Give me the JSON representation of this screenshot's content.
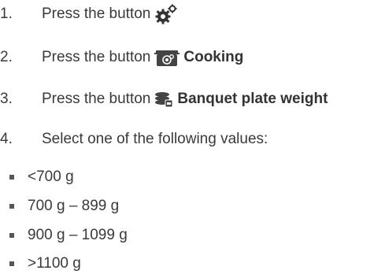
{
  "steps": [
    {
      "number": "1.",
      "text": "Press the button",
      "icon": "gears-icon",
      "label": ""
    },
    {
      "number": "2.",
      "text": "Press the button",
      "icon": "cooking-pot-icon",
      "label": "Cooking"
    },
    {
      "number": "3.",
      "text": "Press the button",
      "icon": "plate-stack-icon",
      "label": "Banquet plate weight"
    },
    {
      "number": "4.",
      "text": "Select one of the following values:"
    }
  ],
  "values": [
    "<700 g",
    "700 g – 899 g",
    "900 g – 1099 g",
    ">1100 g"
  ]
}
